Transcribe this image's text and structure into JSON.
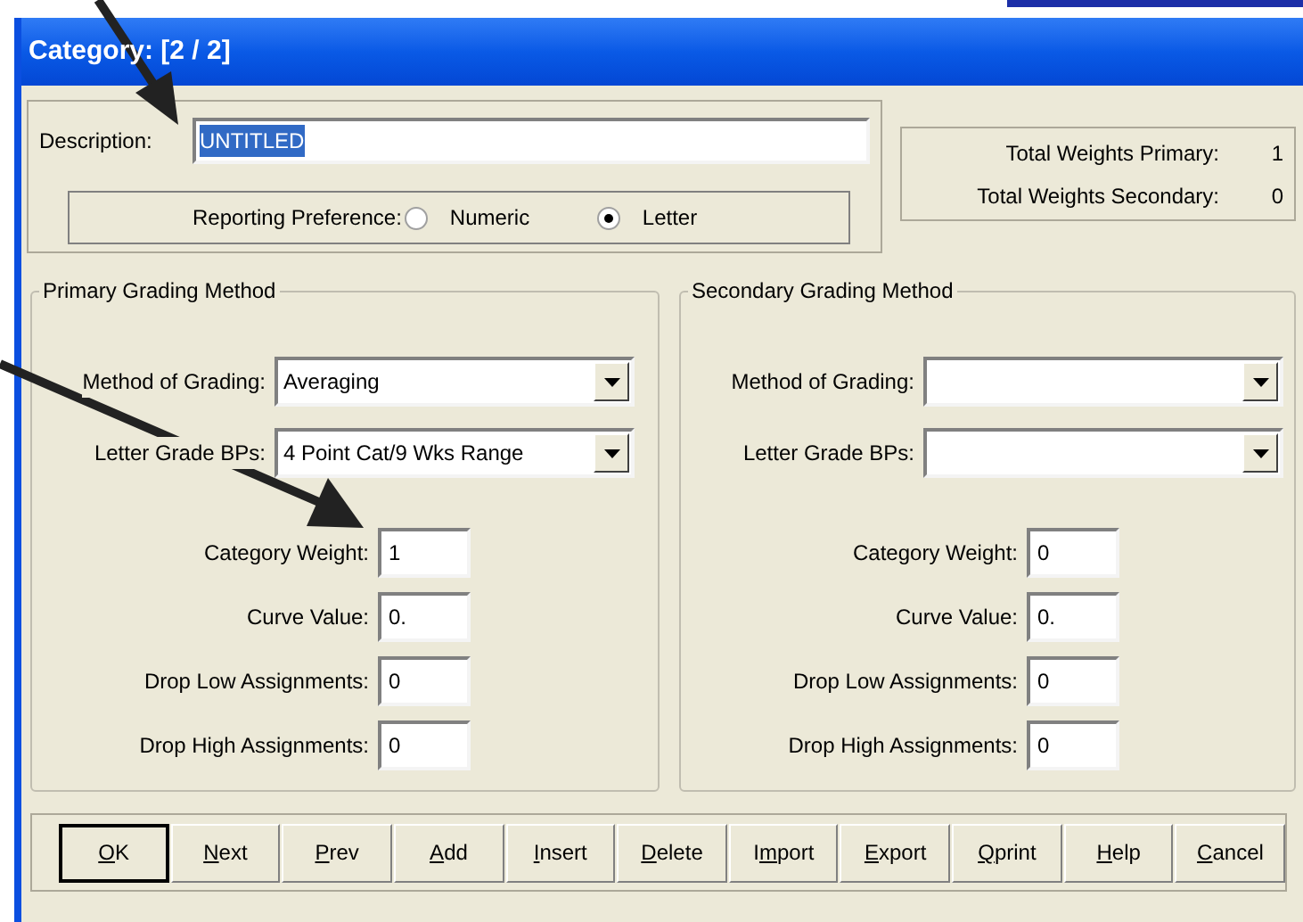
{
  "window": {
    "title": "Category: [2 / 2]"
  },
  "description": {
    "label": "Description:",
    "value": "UNTITLED",
    "text_selected": true
  },
  "reporting_preference": {
    "label": "Reporting Preference:",
    "options": [
      {
        "label": "Numeric",
        "selected": false
      },
      {
        "label": "Letter",
        "selected": true
      }
    ]
  },
  "totals": [
    {
      "label": "Total Weights Primary:",
      "value": "1"
    },
    {
      "label": "Total Weights Secondary:",
      "value": "0"
    }
  ],
  "grading_methods": [
    {
      "title": "Primary Grading Method",
      "dropdowns": [
        {
          "label": "Method of Grading:",
          "value": "Averaging"
        },
        {
          "label": "Letter Grade BPs:",
          "value": "4 Point Cat/9 Wks Range"
        }
      ],
      "fields": [
        {
          "label": "Category Weight:",
          "value": "1"
        },
        {
          "label": "Curve Value:",
          "value": "0."
        },
        {
          "label": "Drop Low Assignments:",
          "value": "0"
        },
        {
          "label": "Drop High Assignments:",
          "value": "0"
        }
      ]
    },
    {
      "title": "Secondary Grading Method",
      "dropdowns": [
        {
          "label": "Method of Grading:"
        },
        {
          "label": "Letter Grade BPs:"
        }
      ],
      "fields": [
        {
          "label": "Category Weight:",
          "value": "0"
        },
        {
          "label": "Curve Value:",
          "value": "0."
        },
        {
          "label": "Drop Low Assignments:",
          "value": "0"
        },
        {
          "label": "Drop High Assignments:",
          "value": "0"
        }
      ]
    }
  ],
  "buttons": [
    {
      "key": "O",
      "after": "K",
      "default": true
    },
    {
      "key": "N",
      "after": "ext",
      "default": false
    },
    {
      "key": "P",
      "after": "rev",
      "default": false
    },
    {
      "key": "A",
      "after": "dd",
      "default": false
    },
    {
      "key": "I",
      "after": "nsert",
      "default": false
    },
    {
      "key": "D",
      "after": "elete",
      "default": false
    },
    {
      "before": "I",
      "key": "m",
      "after": "port",
      "default": false
    },
    {
      "key": "E",
      "after": "xport",
      "default": false
    },
    {
      "key": "Q",
      "after": "print",
      "default": false
    },
    {
      "key": "H",
      "after": "elp",
      "default": false
    },
    {
      "key": "C",
      "after": "ancel",
      "default": false
    }
  ]
}
